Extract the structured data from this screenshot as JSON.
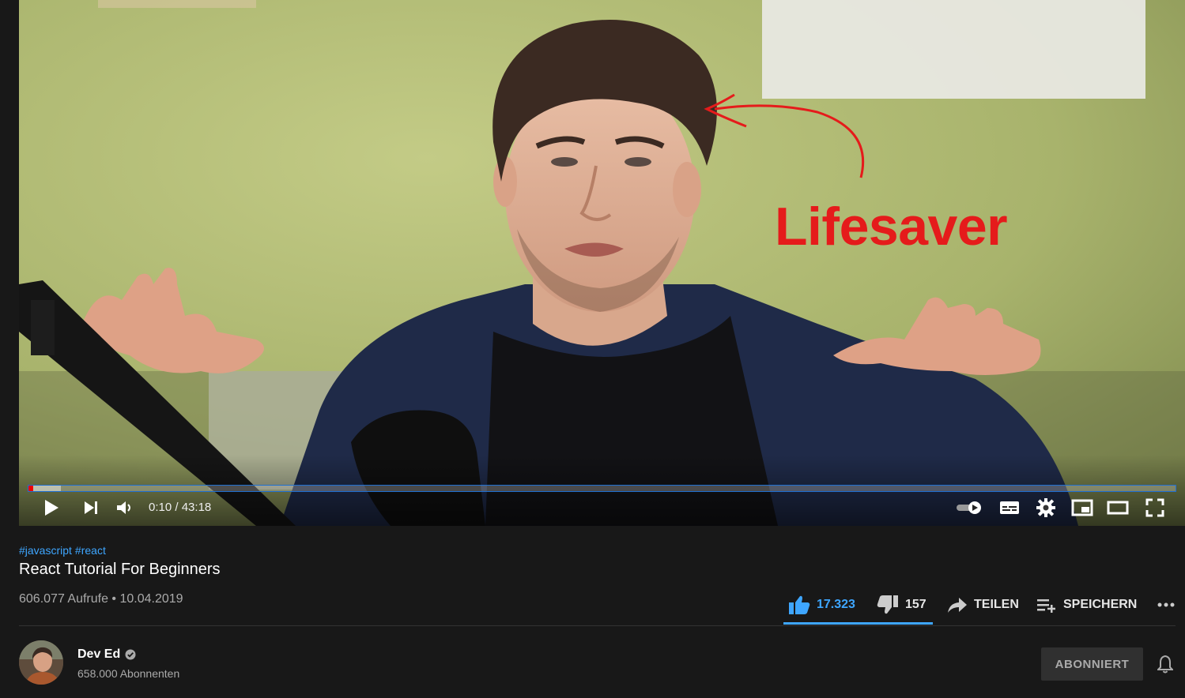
{
  "player": {
    "annotation_text": "Lifesaver",
    "time_current": "0:10",
    "time_separator": "/",
    "time_total": "43:18",
    "progress_fraction": 0.004,
    "buffered_fraction": 0.028,
    "icons": [
      "play-icon",
      "next-icon",
      "volume-icon",
      "autoplay-toggle-icon",
      "subtitles-icon",
      "settings-icon",
      "miniplayer-icon",
      "theater-mode-icon",
      "fullscreen-icon"
    ]
  },
  "video": {
    "hashtags": [
      "#javascript",
      "#react"
    ],
    "title": "React Tutorial For Beginners",
    "meta": "606.077 Aufrufe • 10.04.2019"
  },
  "actions": {
    "likes": "17.323",
    "dislikes": "157",
    "share": "TEILEN",
    "save": "SPEICHERN"
  },
  "channel": {
    "name": "Dev Ed",
    "subscribers": "658.000 Abonnenten",
    "subscribe_label": "ABONNIERT"
  },
  "colors": {
    "accent": "#3ea6ff",
    "annotation": "#e51b1b",
    "progress": "#ff0000",
    "background": "#181818"
  }
}
